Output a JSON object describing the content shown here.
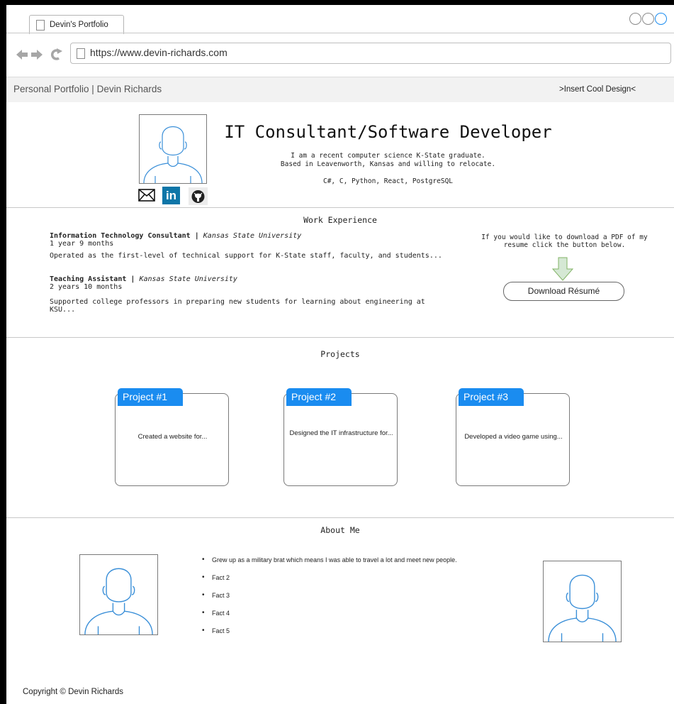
{
  "browser": {
    "tab_title": "Devin's Portfolio",
    "url": "https://www.devin-richards.com"
  },
  "navbar": {
    "brand": "Personal Portfolio | Devin Richards",
    "right_text": ">Insert Cool Design<"
  },
  "header": {
    "title": "IT Consultant/Software Developer",
    "intro_line1": "I am a recent computer science K-State graduate.",
    "intro_line2": "Based in Leavenworth, Kansas and willing to relocate.",
    "skills": "C#, C, Python, React, PostgreSQL",
    "social": {
      "email_icon": "mail-icon",
      "linkedin_label": "in",
      "github_icon": "github-icon"
    }
  },
  "work": {
    "heading": "Work Experience",
    "jobs": [
      {
        "title": "Information Technology Consultant",
        "separator": "|",
        "org": "Kansas State University",
        "duration": "1 year 9 months",
        "desc": "Operated as the first-level of technical support for K-State staff, faculty, and students..."
      },
      {
        "title": "Teaching Assistant",
        "separator": "|",
        "org": "Kansas State University",
        "duration": "2 years 10 months",
        "desc": "Supported college professors in preparing new students for learning about engineering at KSU..."
      }
    ],
    "resume_text": "If you would like to download a PDF of my resume click the button below.",
    "resume_button": "Download Résumé"
  },
  "projects": {
    "heading": "Projects",
    "items": [
      {
        "label": "Project #1",
        "desc": "Created a website for..."
      },
      {
        "label": "Project #2",
        "desc": "Designed the IT infrastructure for..."
      },
      {
        "label": "Project #3",
        "desc": "Developed a video game using..."
      }
    ]
  },
  "about": {
    "heading": "About Me",
    "facts": [
      "Grew up as a military brat which means I was able to travel a lot and meet new people.",
      "Fact 2",
      "Fact 3",
      "Fact 4",
      "Fact 5"
    ]
  },
  "footer": {
    "copyright": "Copyright © Devin Richards"
  },
  "colors": {
    "accent": "#1a8cf0",
    "avatar_stroke": "#3a8fd8",
    "arrow_fill": "#d5e8d4",
    "arrow_stroke": "#82b366"
  }
}
